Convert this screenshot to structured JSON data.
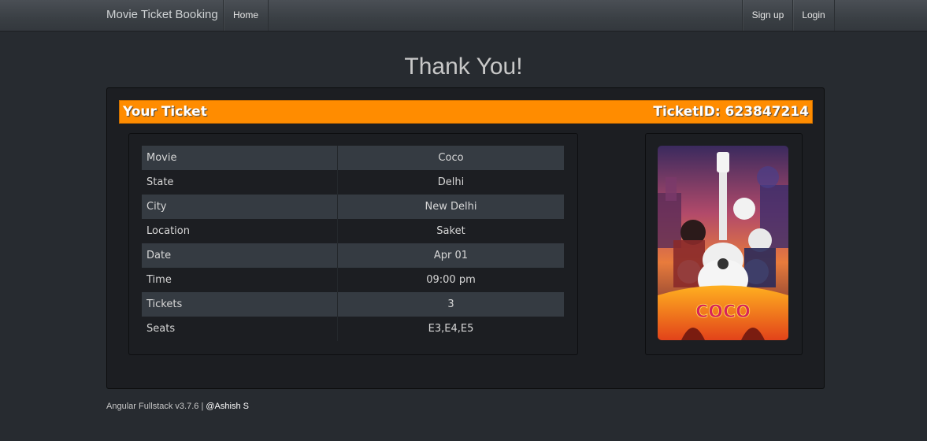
{
  "navbar": {
    "brand": "Movie Ticket Booking",
    "home": "Home",
    "signup": "Sign up",
    "login": "Login"
  },
  "page": {
    "title": "Thank You!"
  },
  "ticket": {
    "header_left": "Your Ticket",
    "header_right": "TicketID: 623847214",
    "rows": [
      {
        "label": "Movie",
        "value": "Coco"
      },
      {
        "label": "State",
        "value": "Delhi"
      },
      {
        "label": "City",
        "value": "New Delhi"
      },
      {
        "label": "Location",
        "value": "Saket"
      },
      {
        "label": "Date",
        "value": "Apr 01"
      },
      {
        "label": "Time",
        "value": "09:00 pm"
      },
      {
        "label": "Tickets",
        "value": "3"
      },
      {
        "label": "Seats",
        "value": "E3,E4,E5"
      }
    ],
    "poster_title": "COCO"
  },
  "footer": {
    "text": "Angular Fullstack v3.7.6 |",
    "author": "@Ashish S"
  },
  "colors": {
    "background": "#272b30",
    "accent": "#ff8c00",
    "table_stripe": "#353b42"
  }
}
